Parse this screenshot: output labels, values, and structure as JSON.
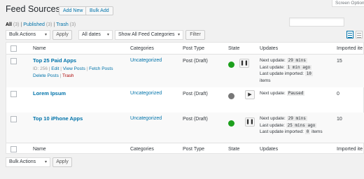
{
  "header": {
    "title": "Feed Sources",
    "add_new": "Add New",
    "bulk_add": "Bulk Add",
    "screen_options": "Screen Options"
  },
  "views": {
    "all": "All",
    "all_count": "(3)",
    "sep1": "|",
    "published": "Published",
    "published_count": "(3)",
    "sep2": "|",
    "trash": "Trash",
    "trash_count": "(3)"
  },
  "filters": {
    "bulk_actions": "Bulk Actions",
    "apply": "Apply",
    "dates": "All dates",
    "categories": "Show All Feed Categories",
    "filter": "Filter"
  },
  "columns": {
    "name": "Name",
    "categories": "Categories",
    "post_type": "Post Type",
    "state": "State",
    "updates": "Updates",
    "imported": "Imported ite"
  },
  "rows": [
    {
      "name": "Top 25 Paid Apps",
      "id": "ID: 256",
      "edit": "Edit",
      "view_posts": "View Posts",
      "fetch_posts": "Fetch Posts",
      "delete_posts": "Delete Posts",
      "trash": "Trash",
      "category": "Uncategorized",
      "post_type": "Post (Draft)",
      "state_color": "#1da01d",
      "control": "❚❚",
      "next_label": "Next update:",
      "next_value": "29 mins",
      "last_label": "Last update:",
      "last_value": "1 min ago",
      "imported_label": "Last update imported:",
      "imported_value": "10",
      "items": "items",
      "imported_count": "15"
    },
    {
      "name": "Lorem Ipsum",
      "category": "Uncategorized",
      "post_type": "Post (Draft)",
      "state_color": "#777777",
      "control": "▶",
      "next_label": "Next update:",
      "next_value": "Paused",
      "imported_count": "0"
    },
    {
      "name": "Top 10 iPhone Apps",
      "category": "Uncategorized",
      "post_type": "Post (Draft)",
      "state_color": "#1da01d",
      "control": "❚❚",
      "next_label": "Next update:",
      "next_value": "29 mins",
      "last_label": "Last update:",
      "last_value": "25 mins ago",
      "imported_label": "Last update imported:",
      "imported_value": "0",
      "items": "items",
      "imported_count": "10"
    }
  ],
  "footer": {
    "bulk_actions": "Bulk Actions",
    "apply": "Apply"
  }
}
